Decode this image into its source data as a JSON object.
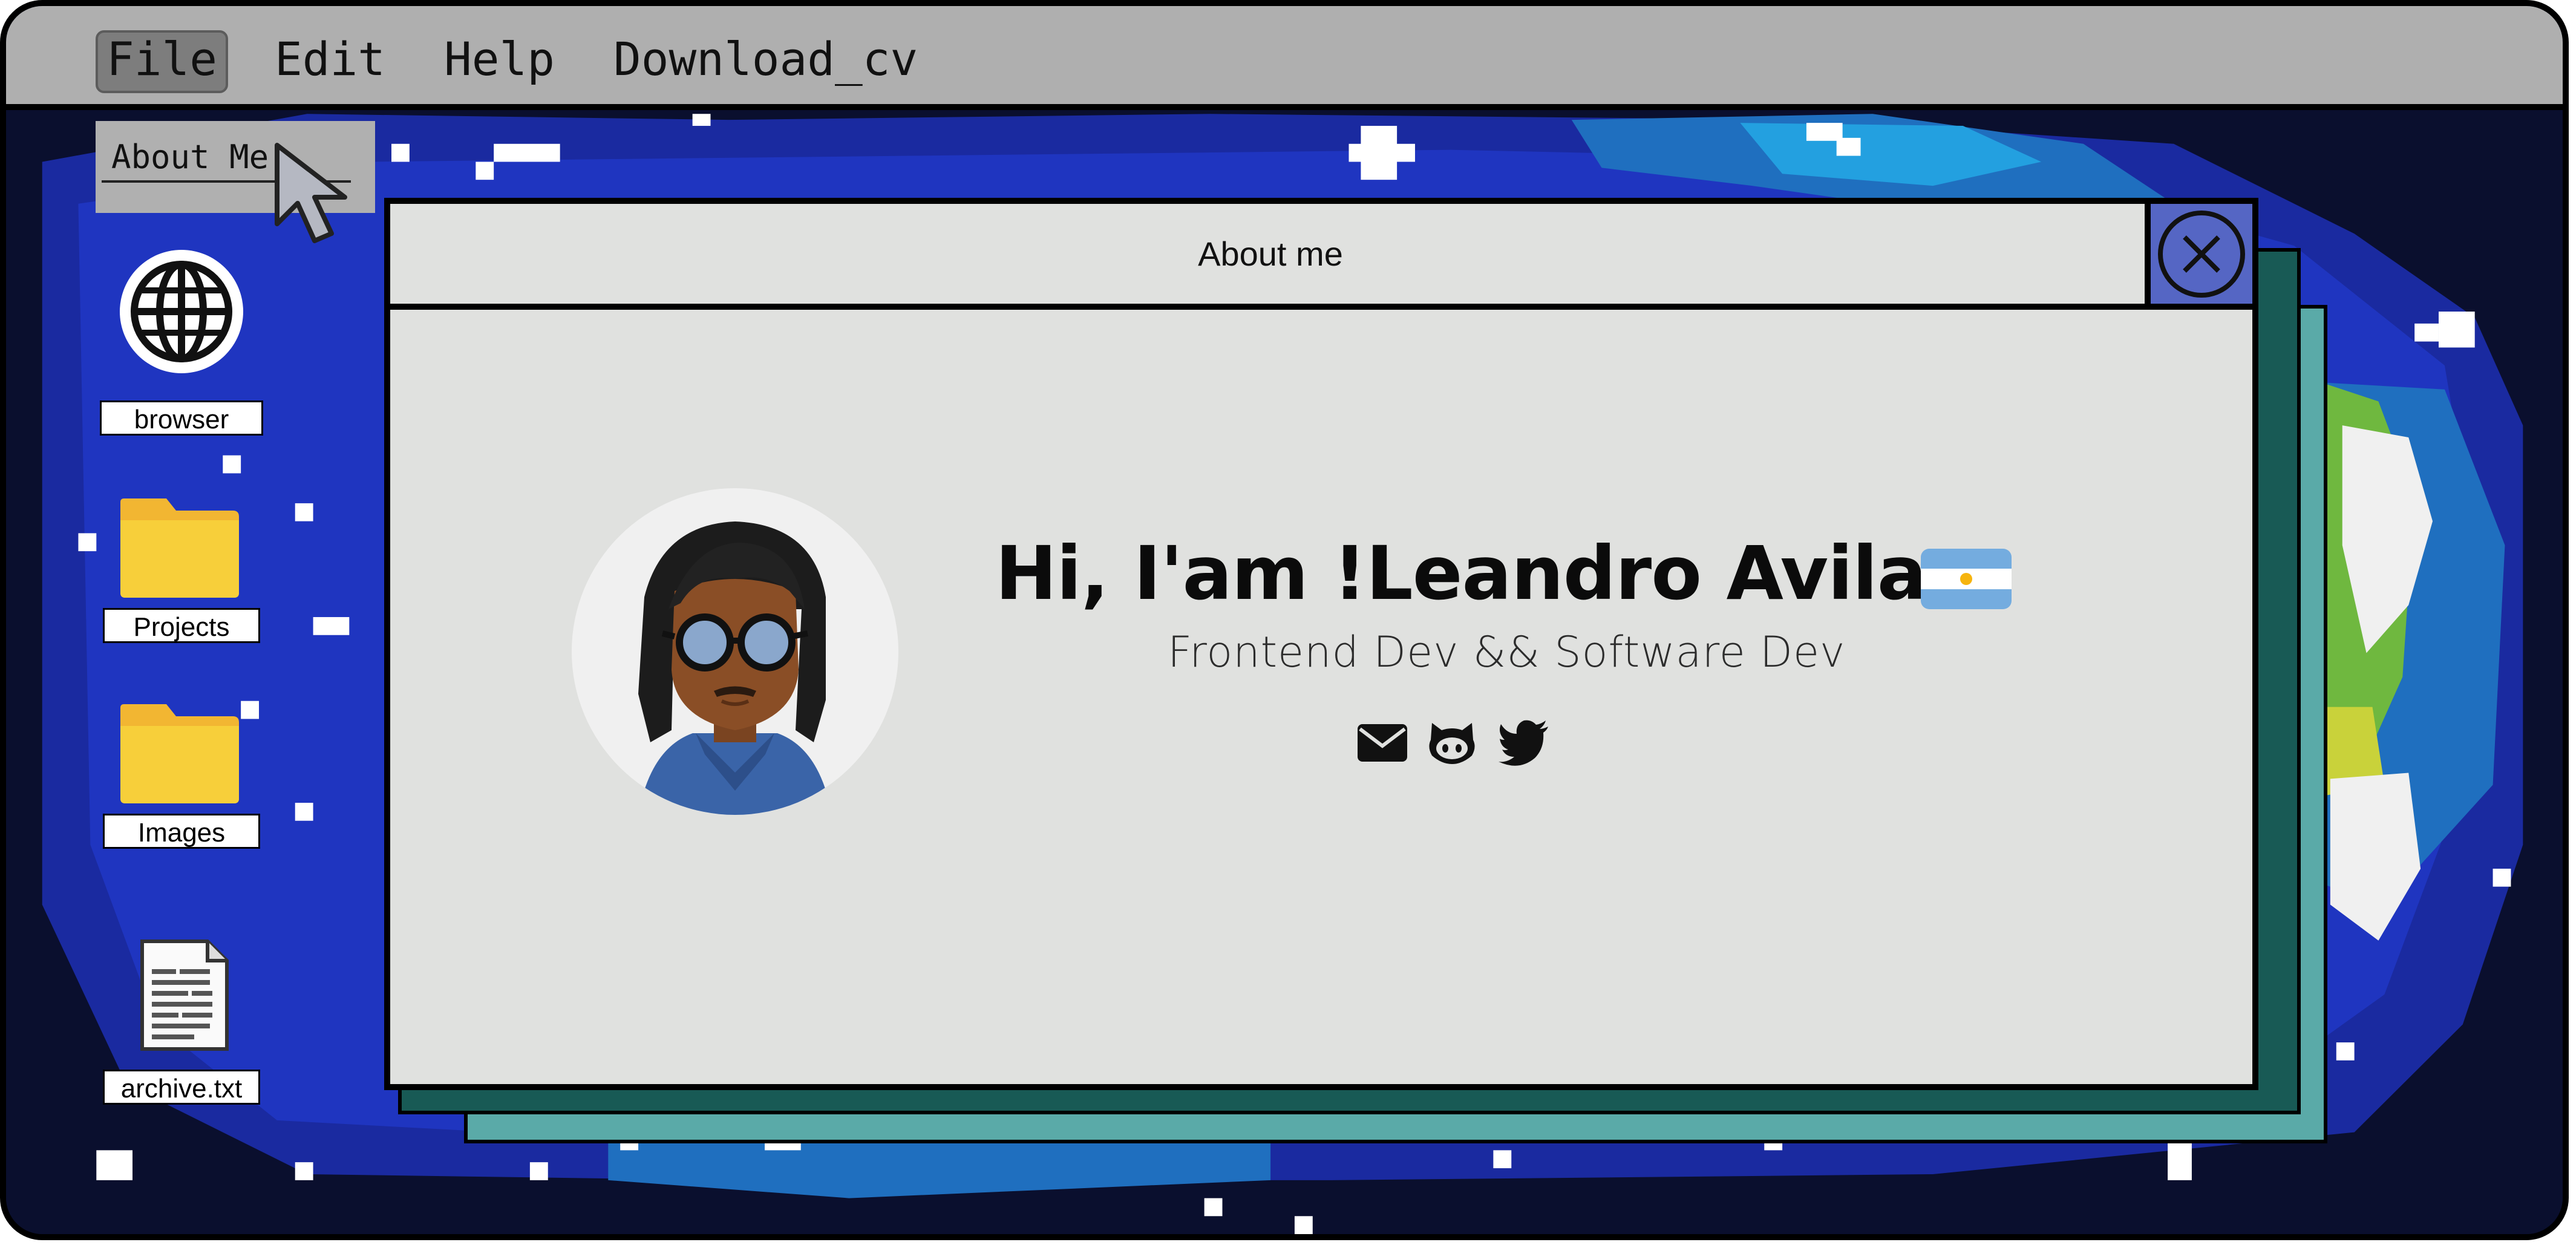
{
  "menubar": {
    "items": [
      {
        "label": "File",
        "active": true
      },
      {
        "label": "Edit",
        "active": false
      },
      {
        "label": "Help",
        "active": false
      },
      {
        "label": "Download_cv",
        "active": false
      }
    ]
  },
  "dropdown": {
    "items": [
      {
        "label": "About Me"
      }
    ]
  },
  "desktop": {
    "icons": [
      {
        "label": "browser",
        "icon": "globe-icon"
      },
      {
        "label": "Projects",
        "icon": "folder-icon"
      },
      {
        "label": "Images",
        "icon": "folder-icon"
      },
      {
        "label": "archive.txt",
        "icon": "text-file-icon"
      }
    ]
  },
  "window": {
    "title": "About me",
    "headline": "Hi, I'am !Leandro Avila",
    "subtitle": "Frontend Dev && Software Dev",
    "flag": "argentina-flag",
    "social": [
      "email-icon",
      "github-icon",
      "twitter-icon"
    ]
  },
  "colors": {
    "menubar": "#afafaf",
    "window_bg": "#e0e1df",
    "close_button": "#5566c4",
    "shadow_dark": "#185a55",
    "shadow_light": "#5aaaa8",
    "space_bg": "#0a0f2e"
  }
}
